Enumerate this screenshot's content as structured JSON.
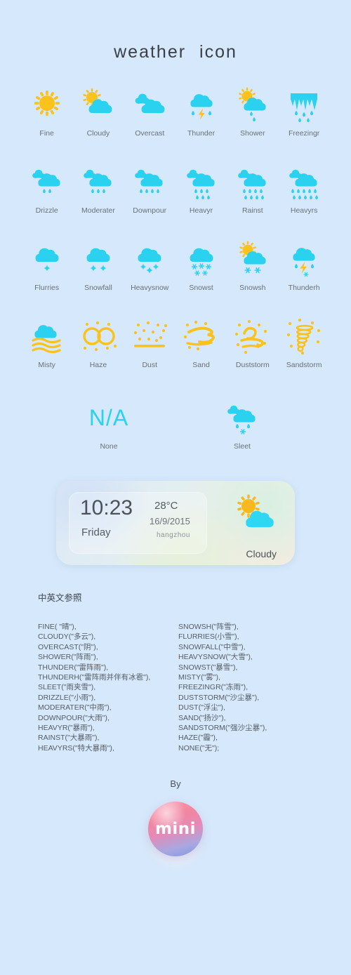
{
  "page": {
    "title": "weather   icon",
    "background": "#d6e8fb",
    "cyan": "#2ad2ef",
    "gold": "#fbc21b"
  },
  "icons": [
    {
      "label": "Fine",
      "art": "sun"
    },
    {
      "label": "Cloudy",
      "art": "sun-cloud"
    },
    {
      "label": "Overcast",
      "art": "double-cloud"
    },
    {
      "label": "Thunder",
      "art": "cloud-thunder"
    },
    {
      "label": "Shower",
      "art": "sun-cloud-rain"
    },
    {
      "label": "Freezingr",
      "art": "icicle-rain"
    },
    {
      "label": "Drizzle",
      "art": "cloud-rain-2"
    },
    {
      "label": "Moderater",
      "art": "cloud-rain-3"
    },
    {
      "label": "Downpour",
      "art": "cloud-rain-4"
    },
    {
      "label": "Heavyr",
      "art": "cloud-rain-6"
    },
    {
      "label": "Rainst",
      "art": "cloud-rain-8"
    },
    {
      "label": "Heavyrs",
      "art": "cloud-rain-10"
    },
    {
      "label": "Flurries",
      "art": "cloud-snow-1"
    },
    {
      "label": "Snowfall",
      "art": "cloud-snow-2"
    },
    {
      "label": "Heavysnow",
      "art": "cloud-snow-3"
    },
    {
      "label": "Snowst",
      "art": "cloud-snow-6"
    },
    {
      "label": "Snowsh",
      "art": "sun-cloud-snow"
    },
    {
      "label": "Thunderh",
      "art": "cloud-thunder-hail"
    },
    {
      "label": "Misty",
      "art": "cloud-mist"
    },
    {
      "label": "Haze",
      "art": "haze-rings"
    },
    {
      "label": "Dust",
      "art": "dust-dots"
    },
    {
      "label": "Sand",
      "art": "sand-swirl"
    },
    {
      "label": "Duststorm",
      "art": "wind-dust"
    },
    {
      "label": "Sandstorm",
      "art": "tornado"
    }
  ],
  "extra_icons": [
    {
      "label": "None",
      "art": "na-text",
      "text": "N/A"
    },
    {
      "label": "Sleet",
      "art": "cloud-sleet"
    }
  ],
  "widget": {
    "time": "10:23",
    "weekday": "Friday",
    "temperature": "28°C",
    "date": "16/9/2015",
    "city": "hangzhou",
    "condition": "Cloudy"
  },
  "reference": {
    "heading": "中英文参照",
    "left": [
      "FINE( \"晴\"),",
      "CLOUDY(\"多云\"),",
      "OVERCAST(\"阴\"),",
      "SHOWER(\"阵雨\"),",
      "THUNDER(\"雷阵雨\"),",
      "THUNDERH(\"雷阵雨并伴有冰雹\"),",
      "SLEET(\"雨夹雪\"),",
      "DRIZZLE(\"小雨\"),",
      "MODERATER(\"中雨\"),",
      "DOWNPOUR(\"大雨\"),",
      "HEAVYR(\"暴雨\"),",
      "RAINST(\"大暴雨\"),",
      "HEAVYRS(\"特大暴雨\"),"
    ],
    "right": [
      "SNOWSH(\"阵雪\"),",
      "FLURRIES(小雪\"),",
      "SNOWFALL(\"中雪\"),",
      "HEAVYSNOW(\"大雪\"),",
      "SNOWST(\"暴雪\"),",
      "MISTY(\"雾\"),",
      "FREEZINGR(\"冻雨\"),",
      "DUSTSTORM(\"沙尘暴\"),",
      "DUST(\"浮尘\"),",
      "SAND(\"扬沙\"),",
      "SANDSTORM(\"强沙尘暴\"),",
      "HAZE(\"霾\"),",
      "NONE(\"无\");"
    ]
  },
  "footer": {
    "by": "By",
    "logo_text": "mini"
  }
}
